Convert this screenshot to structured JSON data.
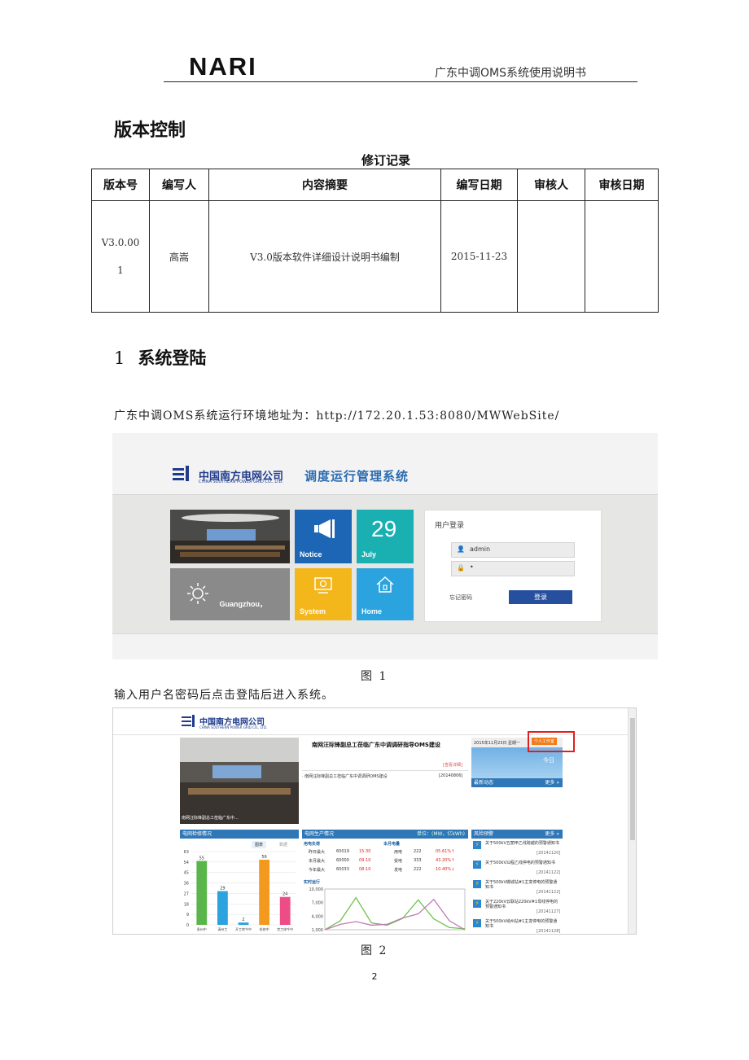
{
  "header": {
    "logo": "NARI",
    "doc_title": "广东中调OMS系统使用说明书"
  },
  "version_heading": "版本控制",
  "revision_table": {
    "caption": "修订记录",
    "columns": [
      "版本号",
      "编写人",
      "内容摘要",
      "编写日期",
      "审核人",
      "审核日期"
    ],
    "rows": [
      {
        "version": "V3.0.00 1",
        "author": "高嵩",
        "summary": "V3.0版本软件详细设计说明书编制",
        "date": "2015-11-23",
        "reviewer": "",
        "review_date": ""
      }
    ]
  },
  "section1": {
    "number": "1",
    "title": "系统登陆"
  },
  "env_line": "广东中调OMS系统运行环境地址为：http://172.20.1.53:8080/MWWebSite/",
  "figure1": {
    "caption": "图 1",
    "company_cn": "中国南方电网公司",
    "company_en": "CHINA SOUTHERN POWER GRID CO., LTD.",
    "system_name": "调度运行管理系统",
    "tiles": {
      "notice": "Notice",
      "date_num": "29",
      "date_month": "July",
      "weather": "Guangzhou，",
      "system": "System",
      "home": "Home"
    },
    "login": {
      "title": "用户登录",
      "username": "admin",
      "password": "•",
      "forgot": "忘记密码",
      "submit": "登录"
    }
  },
  "after_login_line": "输入用户名密码后点击登陆后进入系统。",
  "figure2": {
    "caption": "图 2",
    "company_cn": "中国南方电网公司",
    "company_en": "CHINA SOUTHERN POWER GRID CO., LTD.",
    "news_title": "南网汪际锋副总工莅临广东中调调研指导OMS建设",
    "news_more": "[查看详细]",
    "news_item": "· 南网汪际锋副总工莅临广东中调调研OMS建设",
    "news_item_date": "[20140806]",
    "photo_caption": "南网汪际锋副总工莅临广东中…",
    "date_bar": "2015年11月23日 星期一",
    "personal_btn": "个人工作室",
    "today": "今日",
    "recent": "最新动态",
    "more": "更多 »",
    "grid_check": "电网检修情况",
    "grid_tabs": [
      "图表",
      "数据"
    ],
    "production": "电网生产情况",
    "unit": "单位：(MW，亿kWh)",
    "load_hdr": "用电负荷",
    "month_hdr": "本月电量",
    "load_rows": [
      {
        "label": "昨日最大",
        "value": "60019",
        "time": "15:30",
        "kind": "用电",
        "amount": "222",
        "change": "05.61%↑"
      },
      {
        "label": "本月最大",
        "value": "60000",
        "time": "09:10",
        "kind": "受电",
        "amount": "333",
        "change": "43.20%↑"
      },
      {
        "label": "今年最大",
        "value": "60033",
        "time": "08:10",
        "kind": "发电",
        "amount": "222",
        "change": "10.40%↓"
      }
    ],
    "realtime": "实时运行",
    "risk": "风险预警",
    "risk_items": [
      {
        "text": "关于500kV五丽甲乙线跨越的预警通知书",
        "date": "[20141120]"
      },
      {
        "text": "关于500kV汕程乙线停电的预警通知书",
        "date": "[20141122]"
      },
      {
        "text": "关于500kV蝶城站#1主变停电的预警通知书",
        "date": "[20141122]"
      },
      {
        "text": "关于220kV云联站220kV#1母线停电的预警通知书",
        "date": "[20141127]"
      },
      {
        "text": "关于500kV纳州站#1主变停电的预警通知书",
        "date": "[20141128]"
      }
    ]
  },
  "page_number": "2",
  "chart_data": [
    {
      "type": "bar",
      "categories": [
        "贵州中",
        "清州工",
        "开工转今中",
        "检修中",
        "完工修今中"
      ],
      "values": [
        55,
        29,
        2,
        56,
        24
      ],
      "ylim": [
        0,
        63
      ],
      "yticks": [
        0,
        9,
        18,
        27,
        36,
        45,
        54,
        63
      ],
      "colors": [
        "#5ab54a",
        "#2aa3de",
        "#2aa3de",
        "#f39a1e",
        "#ee4c84"
      ]
    },
    {
      "type": "line",
      "ylim": [
        1000,
        10000
      ],
      "yticks": [
        "1,000",
        "4,000",
        "7,000",
        "10,000"
      ],
      "series": [
        {
          "color": "#6cc24a",
          "values": [
            1000,
            3000,
            8100,
            2500,
            2000,
            3500,
            7600,
            3400,
            1500,
            1200
          ]
        },
        {
          "color": "#c07bb6",
          "values": [
            1000,
            2200,
            2800,
            2000,
            2200,
            3600,
            4500,
            7700,
            3000,
            1000
          ]
        }
      ]
    }
  ]
}
